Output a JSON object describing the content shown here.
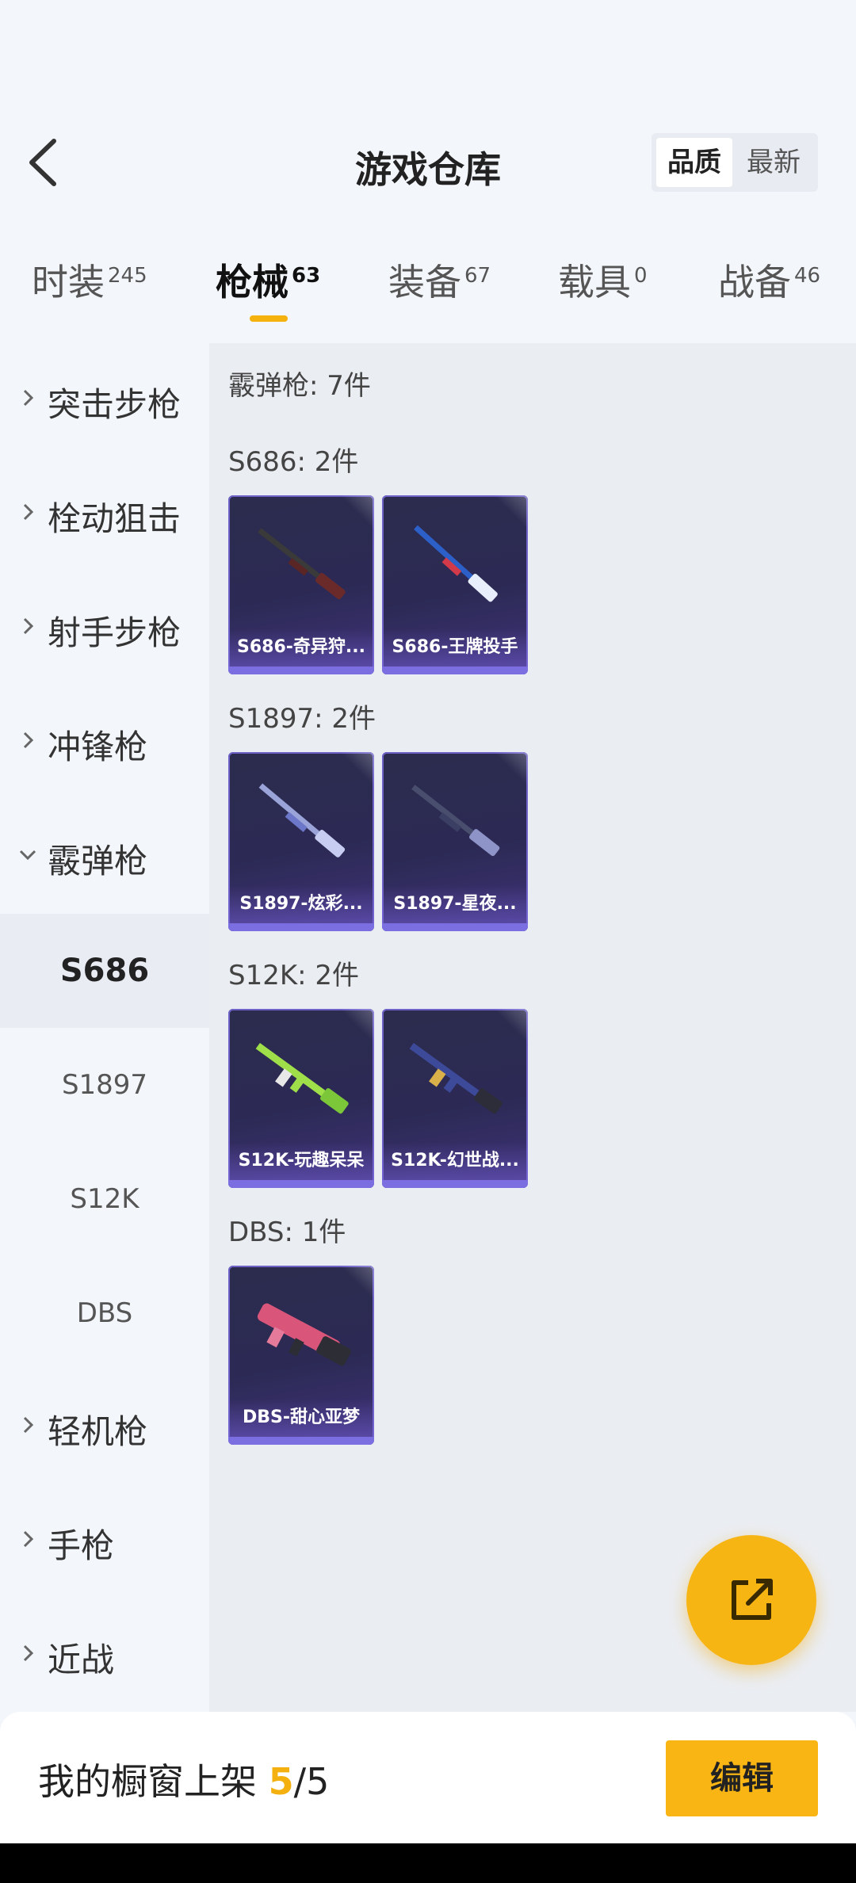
{
  "header": {
    "title": "游戏仓库",
    "sort_options": [
      "品质",
      "最新"
    ]
  },
  "tabs": [
    {
      "label": "时装",
      "count": "245"
    },
    {
      "label": "枪械",
      "count": "63"
    },
    {
      "label": "装备",
      "count": "67"
    },
    {
      "label": "载具",
      "count": "0"
    },
    {
      "label": "战备",
      "count": "46"
    }
  ],
  "sidebar": {
    "categories": [
      "突击步枪",
      "栓动狙击",
      "射手步枪",
      "冲锋枪",
      "霰弹枪",
      "轻机枪",
      "手枪",
      "近战"
    ],
    "sub_items": [
      "S686",
      "S1897",
      "S12K",
      "DBS"
    ]
  },
  "main": {
    "group_title": "霰弹枪: 7件",
    "sections": [
      {
        "title": "S686: 2件",
        "items": [
          "S686-奇异狩...",
          "S686-王牌投手"
        ]
      },
      {
        "title": "S1897: 2件",
        "items": [
          "S1897-炫彩...",
          "S1897-星夜..."
        ]
      },
      {
        "title": "S12K: 2件",
        "items": [
          "S12K-玩趣呆呆",
          "S12K-幻世战..."
        ]
      },
      {
        "title": "DBS: 1件",
        "items": [
          "DBS-甜心亚梦"
        ]
      }
    ]
  },
  "bottom": {
    "label": "我的橱窗上架 ",
    "current": "5",
    "sep": "/",
    "total": "5",
    "edit_label": "编辑"
  },
  "colors": {
    "accent": "#f7b514",
    "card_bg": "#2c2a55",
    "card_border": "#6e62c9"
  }
}
